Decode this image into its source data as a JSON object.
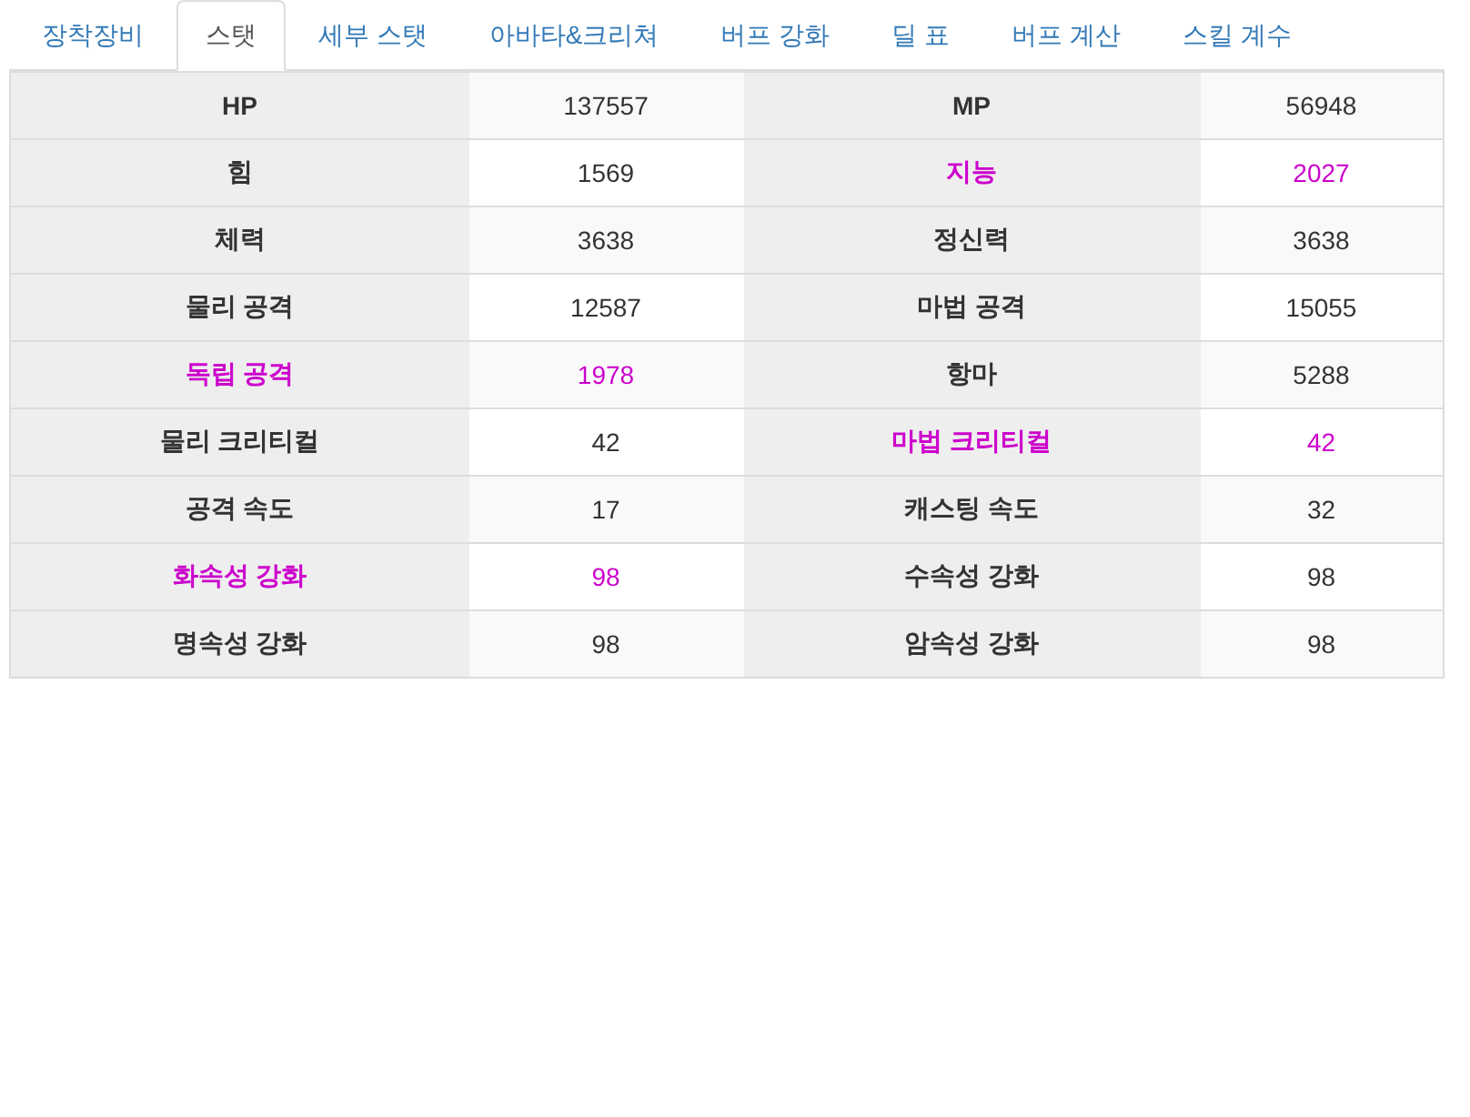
{
  "tabs": [
    {
      "label": "장착장비",
      "selected": false
    },
    {
      "label": "스탯",
      "selected": true
    },
    {
      "label": "세부 스탯",
      "selected": false
    },
    {
      "label": "아바타&크리쳐",
      "selected": false
    },
    {
      "label": "버프 강화",
      "selected": false
    },
    {
      "label": "딜 표",
      "selected": false
    },
    {
      "label": "버프 계산",
      "selected": false
    },
    {
      "label": "스킬 계수",
      "selected": false
    }
  ],
  "stat_rows": [
    {
      "stats": [
        {
          "label": "HP",
          "value": "137557",
          "highlighted": false
        },
        {
          "label": "MP",
          "value": "56948",
          "highlighted": false
        }
      ]
    },
    {
      "stats": [
        {
          "label": "힘",
          "value": "1569",
          "highlighted": false
        },
        {
          "label": "지능",
          "value": "2027",
          "highlighted": true
        }
      ]
    },
    {
      "stats": [
        {
          "label": "체력",
          "value": "3638",
          "highlighted": false
        },
        {
          "label": "정신력",
          "value": "3638",
          "highlighted": false
        }
      ]
    },
    {
      "stats": [
        {
          "label": "물리 공격",
          "value": "12587",
          "highlighted": false
        },
        {
          "label": "마법 공격",
          "value": "15055",
          "highlighted": false
        }
      ]
    },
    {
      "stats": [
        {
          "label": "독립 공격",
          "value": "1978",
          "highlighted": true
        },
        {
          "label": "항마",
          "value": "5288",
          "highlighted": false
        }
      ]
    },
    {
      "stats": [
        {
          "label": "물리 크리티컬",
          "value": "42",
          "highlighted": false
        },
        {
          "label": "마법 크리티컬",
          "value": "42",
          "highlighted": true
        }
      ]
    },
    {
      "stats": [
        {
          "label": "공격 속도",
          "value": "17",
          "highlighted": false
        },
        {
          "label": "캐스팅 속도",
          "value": "32",
          "highlighted": false
        }
      ]
    },
    {
      "stats": [
        {
          "label": "화속성 강화",
          "value": "98",
          "highlighted": true
        },
        {
          "label": "수속성 강화",
          "value": "98",
          "highlighted": false
        }
      ]
    },
    {
      "stats": [
        {
          "label": "명속성 강화",
          "value": "98",
          "highlighted": false
        },
        {
          "label": "암속성 강화",
          "value": "98",
          "highlighted": false
        }
      ]
    }
  ]
}
